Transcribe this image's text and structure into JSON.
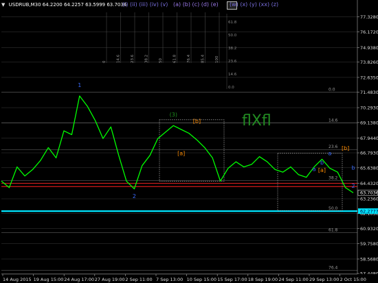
{
  "header": {
    "symbol": "USDRUB,M30",
    "open": "64.2200",
    "high": "64.2257",
    "low": "63.5999",
    "close": "63.7036"
  },
  "wave_labels": {
    "roman": "(i) (ii) (iii) (iv) (v)",
    "letters": "(a) (b) (c) (d) (e)",
    "wxyz": "(w) (x) (y) (xx) (z)"
  },
  "logo_text": "flXfl",
  "colors": {
    "price": "#00ff00",
    "grid": "#3c3c3c",
    "fib": "#777777",
    "support": "#ff2020",
    "cyan": "#00e5ff",
    "orange": "#ff8c00",
    "wave_blue": "#3b6cff",
    "wave_green": "#1f8f1f"
  },
  "chart_data": {
    "type": "line",
    "symbol": "USDRUB",
    "timeframe": "M30",
    "ylim": [
      57.4,
      78.1
    ],
    "x_tick_labels": [
      "14 Aug 2015",
      "19 Aug 15:00",
      "24 Aug 17:00",
      "27 Aug 19:00",
      "2 Sep 11:00",
      "7 Sep 13:00",
      "10 Sep 15:00",
      "15 Sep 17:00",
      "18 Sep 19:00",
      "24 Sep 11:00",
      "29 Sep 13:00",
      "2 Oct 15:00"
    ],
    "y_tick_values": [
      "77.3280",
      "76.1720",
      "74.9380",
      "73.8260",
      "72.6350",
      "71.4830",
      "70.2930",
      "69.1380",
      "67.9440",
      "66.7930",
      "65.6380",
      "64.4320",
      "63.2360",
      "62.1030",
      "60.9320",
      "59.7580",
      "58.5680",
      "57.4480"
    ],
    "price_series": [
      64.6,
      64.1,
      65.7,
      65.0,
      65.5,
      66.2,
      67.2,
      66.4,
      68.5,
      68.2,
      71.2,
      70.4,
      69.3,
      67.9,
      68.8,
      66.6,
      64.6,
      64.0,
      65.8,
      66.6,
      67.9,
      68.4,
      68.9,
      68.6,
      68.3,
      67.8,
      67.2,
      66.4,
      64.6,
      65.6,
      66.1,
      65.7,
      65.9,
      66.5,
      66.1,
      65.5,
      65.3,
      65.7,
      65.1,
      64.9,
      65.7,
      66.3,
      65.6,
      65.3,
      64.1,
      63.7
    ],
    "last_price": "63.7036",
    "horizontal_levels": [
      {
        "name": "cyan-level",
        "value": 62.2777,
        "label": "62.2777"
      },
      {
        "name": "red-level-1",
        "value": 64.43
      },
      {
        "name": "red-level-2",
        "value": 64.18
      }
    ],
    "fib_right_labels": [
      "0.0",
      "14.6",
      "23.6",
      "38.2",
      "50.0",
      "61.8",
      "76.4"
    ],
    "fib_right_levels": [
      71.48,
      69.1,
      67.05,
      64.65,
      62.28,
      60.6,
      57.7
    ],
    "fib_top_labels": [
      "0",
      "14.6",
      "23.6",
      "38.2",
      "50",
      "61.8",
      "76.4",
      "85.4",
      "100"
    ],
    "fib_side_labels": [
      "61.8",
      "50.0",
      "38.2",
      "23.6",
      "14.6",
      "0.0"
    ],
    "wave_marks": [
      {
        "label": "1",
        "color": "wave_blue",
        "time_index": 10,
        "value": 71.9
      },
      {
        "label": "2",
        "color": "wave_blue",
        "time_index": 17,
        "value": 63.3
      },
      {
        "label": "(3)",
        "color": "wave_green",
        "time_index": 22,
        "value": 69.6
      },
      {
        "label": "[b]",
        "color": "orange",
        "time_index": 25,
        "value": 69.1
      },
      {
        "label": "[a]",
        "color": "orange",
        "time_index": 23,
        "value": 66.6
      },
      {
        "label": "a",
        "color": "wave_blue",
        "time_index": 40,
        "value": 65.4
      },
      {
        "label": "b",
        "color": "wave_blue",
        "time_index": 41,
        "value": 65.9
      },
      {
        "label": "[a]",
        "color": "orange",
        "time_index": 41,
        "value": 65.3
      },
      {
        "label": "a",
        "color": "wave_blue",
        "time_index": 42,
        "value": 66.6
      },
      {
        "label": "[b]",
        "color": "orange",
        "time_index": 44,
        "value": 67.0
      },
      {
        "label": "b",
        "color": "wave_blue",
        "time_index": 45,
        "value": 65.5
      },
      {
        "label": "2",
        "color": "wave_blue",
        "time_index": 45,
        "value": 64.1
      }
    ]
  }
}
